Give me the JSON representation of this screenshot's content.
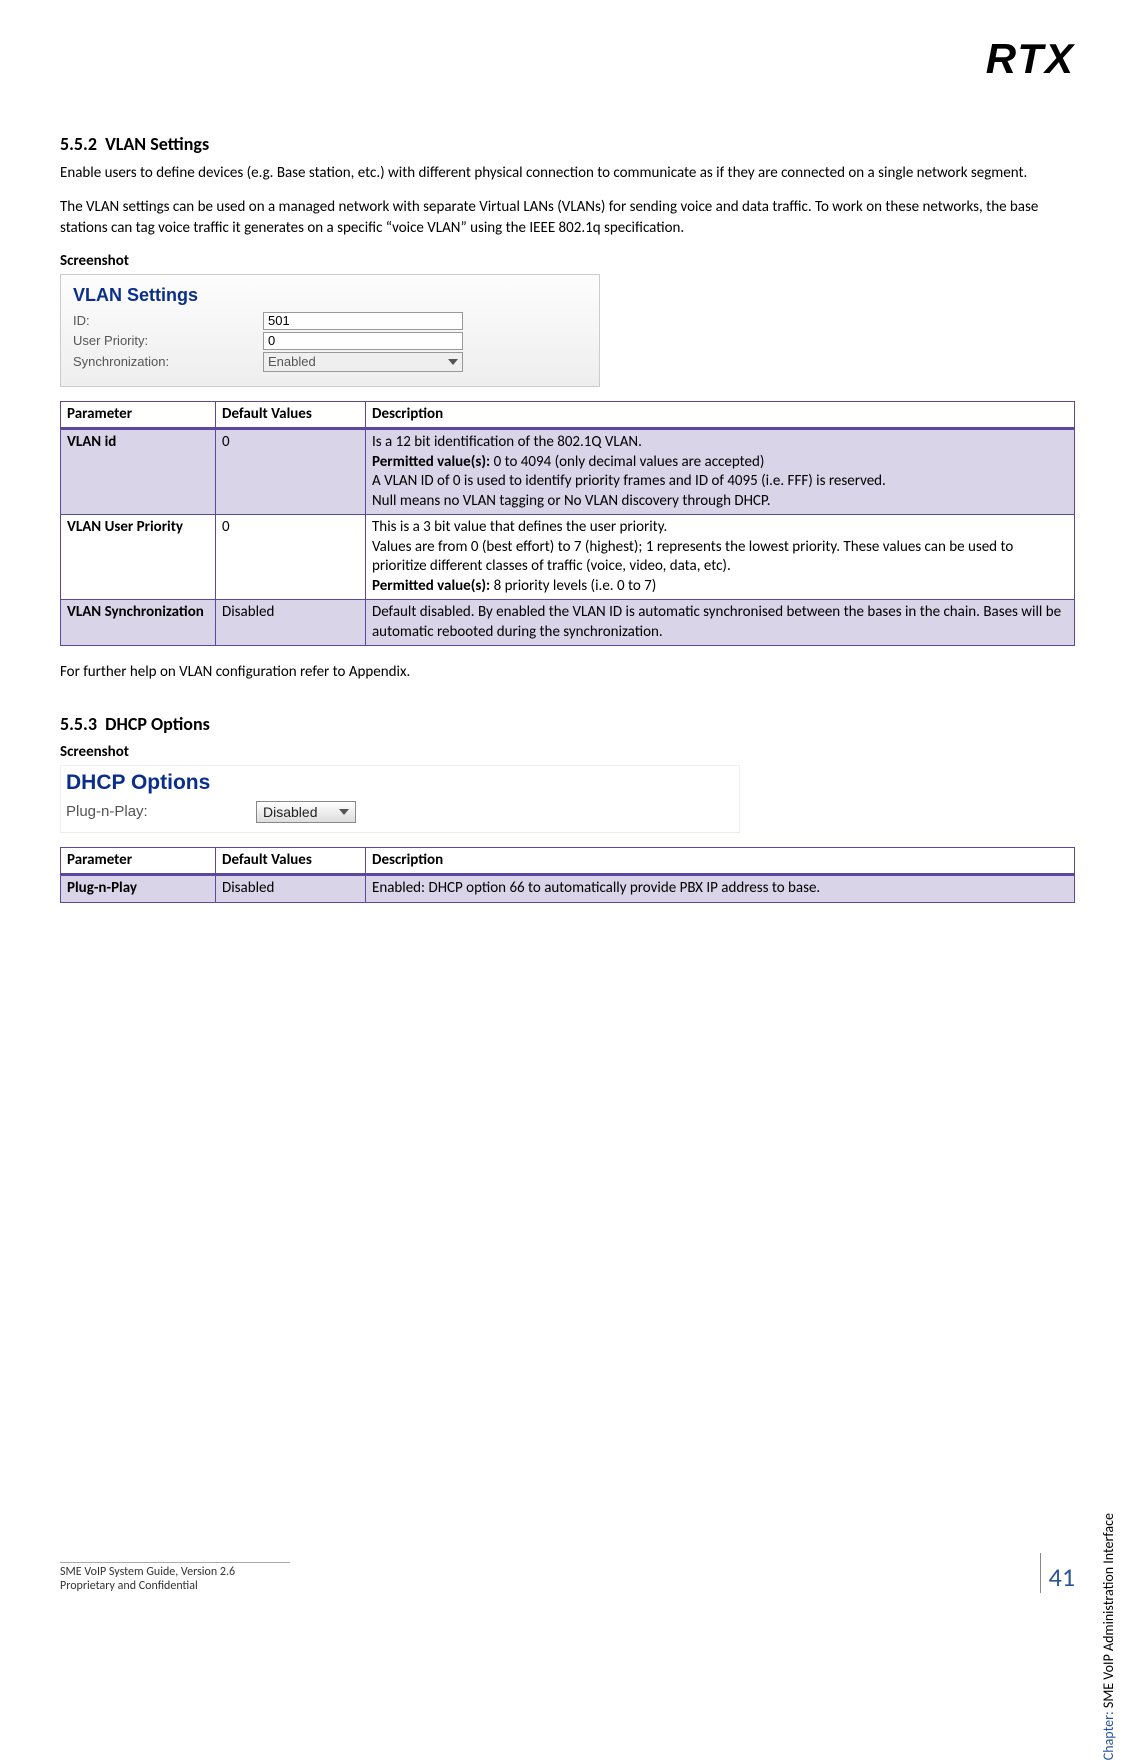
{
  "logo": "RTX",
  "section552": {
    "number": "5.5.2",
    "title": "VLAN Settings",
    "para1": "Enable users to define devices (e.g. Base station, etc.) with different physical connection to communicate as if they are connected on a single network segment.",
    "para2": "The VLAN settings can be used on a managed network with separate Virtual LANs (VLANs) for sending voice and data traffic. To work on these networks, the base stations can tag voice traffic it generates on a specific “voice VLAN” using the IEEE 802.1q specification.",
    "screenshotLabel": "Screenshot",
    "ss": {
      "title": "VLAN Settings",
      "idLabel": "ID:",
      "idValue": "501",
      "upLabel": "User Priority:",
      "upValue": "0",
      "syncLabel": "Synchronization:",
      "syncValue": "Enabled"
    },
    "tableHeaders": {
      "param": "Parameter",
      "default": "Default Values",
      "desc": "Description"
    },
    "rows": [
      {
        "param": "VLAN id",
        "default": "0",
        "desc_l1": "Is a 12 bit identification of the 802.1Q VLAN.",
        "desc_l2a": "Permitted value(s):",
        "desc_l2b": " 0 to 4094 (only decimal values are accepted)",
        "desc_l3": "A VLAN ID of 0 is used to identify priority frames and ID of 4095 (i.e. FFF) is reserved.",
        "desc_l4": "Null means no VLAN tagging or No VLAN discovery through DHCP."
      },
      {
        "param": "VLAN User Priority",
        "default": "0",
        "desc_l1": "This is a 3 bit value that defines the user priority.",
        "desc_l2": "Values are from 0 (best effort) to 7 (highest); 1 represents the lowest priority. These values can be used to prioritize different classes of traffic (voice, video, data, etc).",
        "desc_l3a": "Permitted value(s):",
        "desc_l3b": " 8 priority levels (i.e. 0 to 7)"
      },
      {
        "param": "VLAN Synchronization",
        "default": "Disabled",
        "desc": "Default disabled. By enabled the VLAN ID is automatic synchronised between the bases in the chain. Bases will be automatic rebooted during the synchronization."
      }
    ],
    "afterTable": "For further help on VLAN configuration refer to Appendix."
  },
  "section553": {
    "number": "5.5.3",
    "title": "DHCP Options",
    "screenshotLabel": "Screenshot",
    "ss": {
      "title": "DHCP Options",
      "pnpLabel": "Plug-n-Play:",
      "pnpValue": "Disabled"
    },
    "tableHeaders": {
      "param": "Parameter",
      "default": "Default Values",
      "desc": "Description"
    },
    "rows": [
      {
        "param": "Plug-n-Play",
        "default": "Disabled",
        "desc": "Enabled: DHCP option 66 to automatically provide PBX IP address to base."
      }
    ]
  },
  "footer": {
    "line1": "SME VoIP System Guide, Version 2.6",
    "line2": "Proprietary and Confidential",
    "page": "41",
    "sideChapter": "Chapter:",
    "sideText": " SME VoIP Administration Interface"
  }
}
